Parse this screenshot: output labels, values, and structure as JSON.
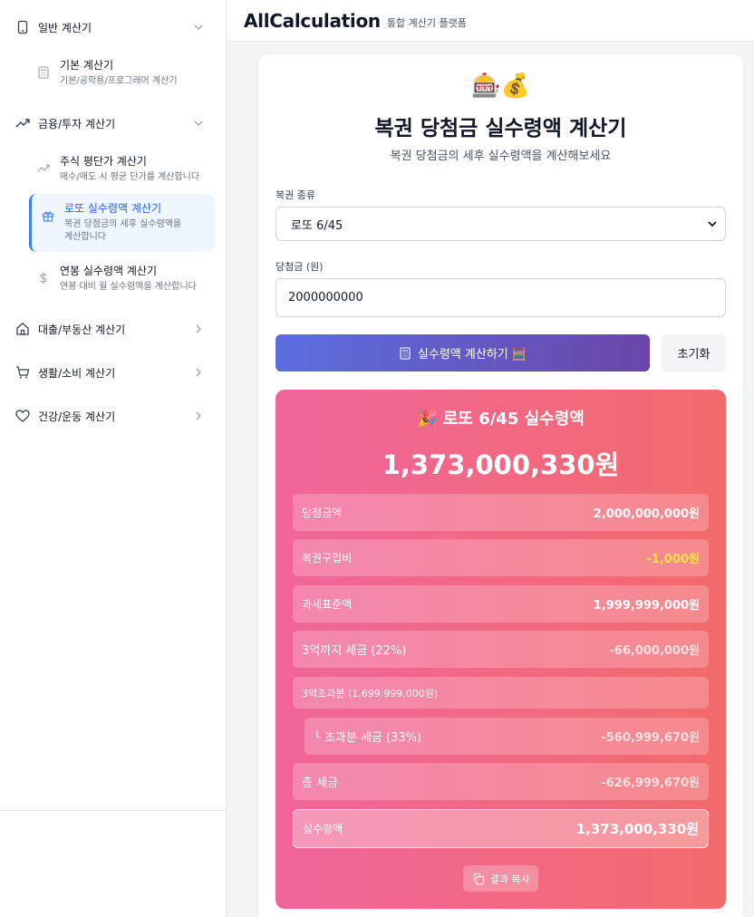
{
  "header": {
    "brand": "AllCalculation",
    "subtitle": "통합 계산기 플랫폼"
  },
  "sidebar": {
    "groups": [
      {
        "label": "일반 계산기",
        "icon": "smartphone-icon",
        "expanded": true
      },
      {
        "label": "금융/투자 계산기",
        "icon": "trending-up-icon",
        "expanded": true
      },
      {
        "label": "대출/부동산 계산기",
        "icon": "home-icon",
        "expanded": false
      },
      {
        "label": "생활/소비 계산기",
        "icon": "cart-icon",
        "expanded": false
      },
      {
        "label": "건강/운동 계산기",
        "icon": "heart-icon",
        "expanded": false
      }
    ],
    "items": [
      {
        "title": "기본 계산기",
        "desc": "기본/공학용/프로그래머 계산기",
        "icon": "calculator-icon"
      },
      {
        "title": "주식 평단가 계산기",
        "desc": "매수/매도 시 평균 단가를 계산합니다",
        "icon": "trending-up-icon"
      },
      {
        "title": "로또 실수령액 계산기",
        "desc": "복권 당첨금의 세후 실수령액을 계산합니다",
        "icon": "gift-icon",
        "active": true
      },
      {
        "title": "연봉 실수령액 계산기",
        "desc": "연봉 대비 월 실수령액을 계산합니다",
        "icon": "dollar-icon"
      }
    ]
  },
  "calculator": {
    "emoji": "🎰💰",
    "title": "복권 당첨금 실수령액 계산기",
    "subtitle": "복권 당첨금의 세후 실수령액을 계산해보세요",
    "type_label": "복권 종류",
    "type_value": "로또 6/45",
    "amount_label": "당첨금 (원)",
    "amount_value": "2000000000",
    "calc_button": "실수령액 계산하기 🧮",
    "reset_button": "초기화"
  },
  "result": {
    "title": "🎉 로또 6/45 실수령액",
    "amount": "1,373,000,330원",
    "rows": [
      {
        "label": "당첨금액",
        "value": "2,000,000,000원"
      },
      {
        "label": "복권구입비",
        "value": "-1,000원"
      },
      {
        "label": "과세표준액",
        "value": "1,999,999,000원"
      },
      {
        "label": "3억까지 세금 (22%)",
        "value": "-66,000,000원"
      },
      {
        "label": "3억초과분 (1,699,999,000원)",
        "value": ""
      },
      {
        "label": "└ 초과분 세금 (33%)",
        "value": "-560,999,670원"
      },
      {
        "label": "총 세금",
        "value": "-626,999,670원"
      },
      {
        "label": "실수령액",
        "value": "1,373,000,330원"
      }
    ],
    "copy_button": "결과 복사"
  },
  "colors": {
    "accent": "#3b82f6",
    "button_gradient_start": "#5b6fe0",
    "button_gradient_end": "#6a46a8",
    "result_gradient_start": "#f0669c",
    "result_gradient_end": "#f36a6b",
    "highlight_yellow": "#fde047"
  }
}
